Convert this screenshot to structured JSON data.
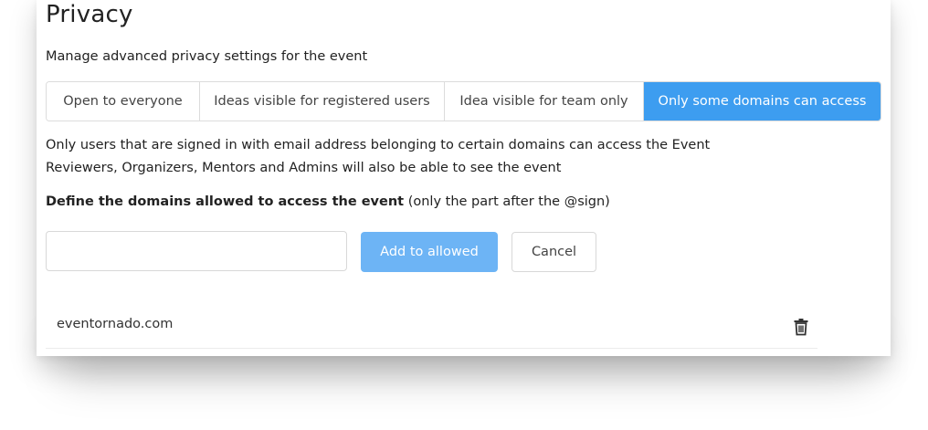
{
  "header": {
    "title": "Privacy",
    "subtitle": "Manage advanced privacy settings for the event"
  },
  "privacy_options": [
    {
      "label": "Open to everyone",
      "active": false
    },
    {
      "label": "Ideas visible for registered users",
      "active": false
    },
    {
      "label": "Idea visible for team only",
      "active": false
    },
    {
      "label": "Only some domains can access",
      "active": true
    }
  ],
  "description": {
    "line1": "Only users that are signed in with email address belonging to certain domains can access the Event",
    "line2": "Reviewers, Organizers, Mentors and Admins will also be able to see the event"
  },
  "define": {
    "bold_label": "Define the domains allowed to access the event",
    "hint": " (only the part after the @sign)"
  },
  "domain_form": {
    "input_value": "",
    "placeholder": "",
    "add_label": "Add to allowed",
    "cancel_label": "Cancel"
  },
  "allowed_domains": [
    {
      "domain": "eventornado.com",
      "icon": "trash-icon"
    }
  ],
  "colors": {
    "accent": "#3d9df0",
    "add_button": "#6db4f5"
  }
}
